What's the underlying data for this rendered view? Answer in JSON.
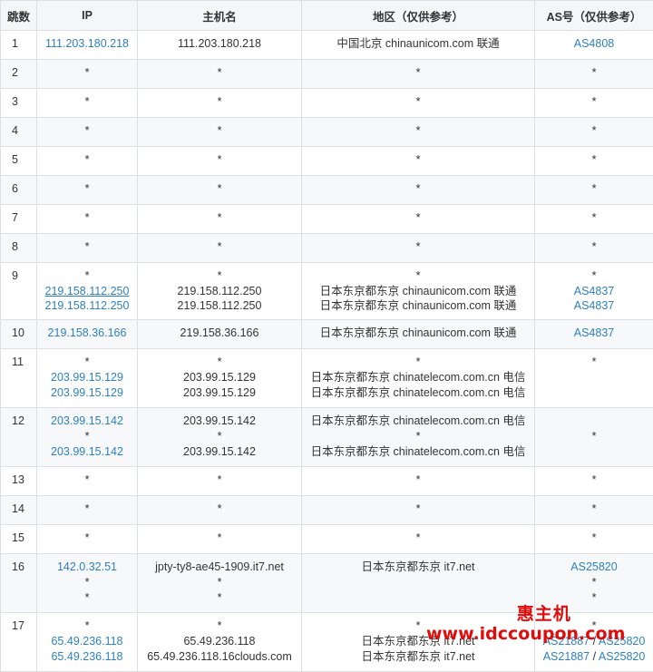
{
  "columns": [
    "跳数",
    "IP",
    "主机名",
    "地区（仅供参考）",
    "AS号（仅供参考）"
  ],
  "rows": [
    {
      "hop": "1",
      "ip": [
        {
          "t": "111.203.180.218",
          "link": true
        }
      ],
      "host": [
        "111.203.180.218"
      ],
      "loc": [
        "中国北京 chinaunicom.com 联通"
      ],
      "as": [
        [
          {
            "t": "AS4808",
            "link": true
          }
        ]
      ]
    },
    {
      "hop": "2",
      "ip": [
        {
          "t": "*"
        }
      ],
      "host": [
        "*"
      ],
      "loc": [
        "*"
      ],
      "as": [
        [
          {
            "t": "*"
          }
        ]
      ]
    },
    {
      "hop": "3",
      "ip": [
        {
          "t": "*"
        }
      ],
      "host": [
        "*"
      ],
      "loc": [
        "*"
      ],
      "as": [
        [
          {
            "t": "*"
          }
        ]
      ]
    },
    {
      "hop": "4",
      "ip": [
        {
          "t": "*"
        }
      ],
      "host": [
        "*"
      ],
      "loc": [
        "*"
      ],
      "as": [
        [
          {
            "t": "*"
          }
        ]
      ]
    },
    {
      "hop": "5",
      "ip": [
        {
          "t": "*"
        }
      ],
      "host": [
        "*"
      ],
      "loc": [
        "*"
      ],
      "as": [
        [
          {
            "t": "*"
          }
        ]
      ]
    },
    {
      "hop": "6",
      "ip": [
        {
          "t": "*"
        }
      ],
      "host": [
        "*"
      ],
      "loc": [
        "*"
      ],
      "as": [
        [
          {
            "t": "*"
          }
        ]
      ]
    },
    {
      "hop": "7",
      "ip": [
        {
          "t": "*"
        }
      ],
      "host": [
        "*"
      ],
      "loc": [
        "*"
      ],
      "as": [
        [
          {
            "t": "*"
          }
        ]
      ]
    },
    {
      "hop": "8",
      "ip": [
        {
          "t": "*"
        }
      ],
      "host": [
        "*"
      ],
      "loc": [
        "*"
      ],
      "as": [
        [
          {
            "t": "*"
          }
        ]
      ]
    },
    {
      "hop": "9",
      "ip": [
        {
          "t": "*"
        },
        {
          "t": "219.158.112.250",
          "link": true,
          "under": true
        },
        {
          "t": "219.158.112.250",
          "link": true
        }
      ],
      "host": [
        "*",
        "219.158.112.250",
        "219.158.112.250"
      ],
      "loc": [
        "*",
        "日本东京都东京 chinaunicom.com 联通",
        "日本东京都东京 chinaunicom.com 联通"
      ],
      "as": [
        [
          {
            "t": "*"
          }
        ],
        [
          {
            "t": "AS4837",
            "link": true
          }
        ],
        [
          {
            "t": "AS4837",
            "link": true
          }
        ]
      ]
    },
    {
      "hop": "10",
      "ip": [
        {
          "t": "219.158.36.166",
          "link": true
        }
      ],
      "host": [
        "219.158.36.166"
      ],
      "loc": [
        "日本东京都东京 chinaunicom.com 联通"
      ],
      "as": [
        [
          {
            "t": "AS4837",
            "link": true
          }
        ]
      ]
    },
    {
      "hop": "11",
      "ip": [
        {
          "t": "*"
        },
        {
          "t": "203.99.15.129",
          "link": true
        },
        {
          "t": "203.99.15.129",
          "link": true
        }
      ],
      "host": [
        "*",
        "203.99.15.129",
        "203.99.15.129"
      ],
      "loc": [
        "*",
        "日本东京都东京 chinatelecom.com.cn 电信",
        "日本东京都东京 chinatelecom.com.cn 电信"
      ],
      "as": [
        [
          {
            "t": "*"
          }
        ]
      ]
    },
    {
      "hop": "12",
      "ip": [
        {
          "t": "203.99.15.142",
          "link": true
        },
        {
          "t": "*"
        },
        {
          "t": "203.99.15.142",
          "link": true
        }
      ],
      "host": [
        "203.99.15.142",
        "*",
        "203.99.15.142"
      ],
      "loc": [
        "日本东京都东京 chinatelecom.com.cn 电信",
        "*",
        "日本东京都东京 chinatelecom.com.cn 电信"
      ],
      "as": [
        [
          {
            "t": ""
          }
        ],
        [
          {
            "t": "*"
          }
        ]
      ]
    },
    {
      "hop": "13",
      "ip": [
        {
          "t": "*"
        }
      ],
      "host": [
        "*"
      ],
      "loc": [
        "*"
      ],
      "as": [
        [
          {
            "t": "*"
          }
        ]
      ]
    },
    {
      "hop": "14",
      "ip": [
        {
          "t": "*"
        }
      ],
      "host": [
        "*"
      ],
      "loc": [
        "*"
      ],
      "as": [
        [
          {
            "t": "*"
          }
        ]
      ]
    },
    {
      "hop": "15",
      "ip": [
        {
          "t": "*"
        }
      ],
      "host": [
        "*"
      ],
      "loc": [
        "*"
      ],
      "as": [
        [
          {
            "t": "*"
          }
        ]
      ]
    },
    {
      "hop": "16",
      "ip": [
        {
          "t": "142.0.32.51",
          "link": true
        },
        {
          "t": "*"
        },
        {
          "t": "*"
        }
      ],
      "host": [
        "jpty-ty8-ae45-1909.it7.net",
        "*",
        "*"
      ],
      "loc": [
        "日本东京都东京 it7.net"
      ],
      "as": [
        [
          {
            "t": "AS25820",
            "link": true
          }
        ],
        [
          {
            "t": "*"
          }
        ],
        [
          {
            "t": "*"
          }
        ]
      ]
    },
    {
      "hop": "17",
      "ip": [
        {
          "t": "*"
        },
        {
          "t": "65.49.236.118",
          "link": true
        },
        {
          "t": "65.49.236.118",
          "link": true
        }
      ],
      "host": [
        "*",
        "65.49.236.118",
        "65.49.236.118.16clouds.com"
      ],
      "loc": [
        "*",
        "日本东京都东京 it7.net",
        "日本东京都东京 it7.net"
      ],
      "as": [
        [
          {
            "t": "*"
          }
        ],
        [
          {
            "t": "AS21887",
            "link": true
          },
          {
            "t": " / ",
            "sep": true
          },
          {
            "t": "AS25820",
            "link": true
          }
        ],
        [
          {
            "t": "AS21887",
            "link": true
          },
          {
            "t": " / ",
            "sep": true
          },
          {
            "t": "AS25820",
            "link": true
          }
        ]
      ]
    }
  ],
  "watermark": {
    "brand": "惠主机",
    "url": "www.idccoupon.com"
  },
  "colors": {
    "link": "#2d7fc1",
    "watermark": "#e00c0c",
    "header_bg": "#f4f6f8",
    "alt_row_bg": "#f7f8fa",
    "border": "#dcdfe4"
  }
}
